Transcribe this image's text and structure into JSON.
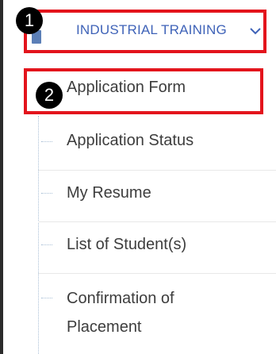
{
  "menu": {
    "header_label": "INDUSTRIAL TRAINING",
    "header_icon": "folder-icon",
    "toggle_icon": "chevron-down-icon",
    "accent_color": "#3f63b8",
    "highlight_color": "#e3141c"
  },
  "annotations": {
    "badge_1": "1",
    "badge_2": "2"
  },
  "items": [
    {
      "label": "Application Form"
    },
    {
      "label": "Application Status"
    },
    {
      "label": "My Resume"
    },
    {
      "label": "List of Student(s)"
    },
    {
      "label": "Confirmation of Placement"
    }
  ]
}
